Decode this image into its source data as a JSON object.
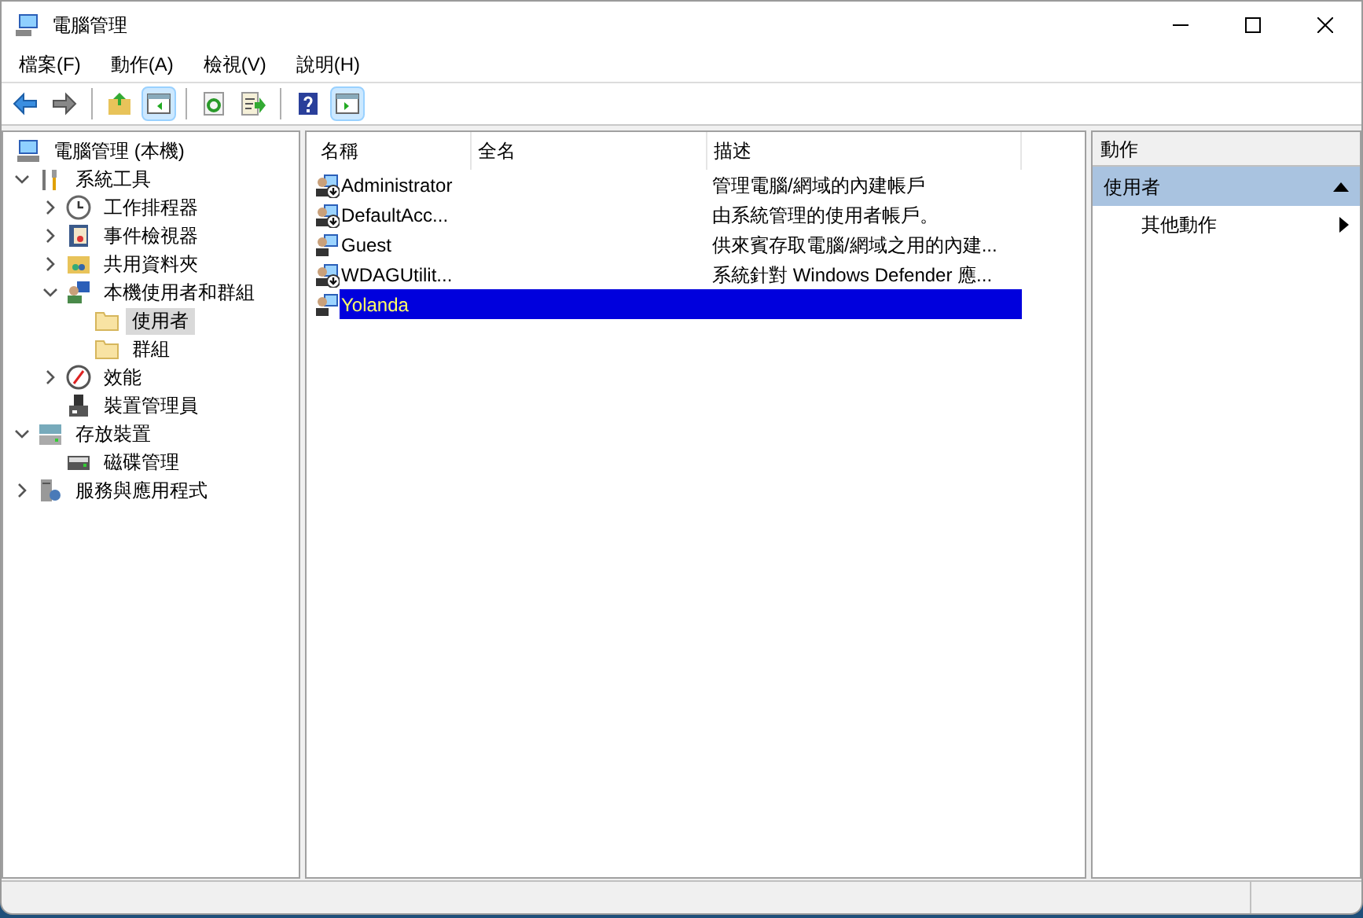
{
  "window": {
    "title": "電腦管理"
  },
  "menu": [
    "檔案(F)",
    "動作(A)",
    "檢視(V)",
    "說明(H)"
  ],
  "toolbar": [
    {
      "kind": "back",
      "pressed": false
    },
    {
      "kind": "forward",
      "pressed": false
    },
    {
      "kind": "separator"
    },
    {
      "kind": "up",
      "pressed": false
    },
    {
      "kind": "tree",
      "pressed": true
    },
    {
      "kind": "separator"
    },
    {
      "kind": "refresh",
      "pressed": false
    },
    {
      "kind": "export",
      "pressed": false
    },
    {
      "kind": "separator"
    },
    {
      "kind": "help",
      "pressed": false
    },
    {
      "kind": "actions",
      "pressed": true
    }
  ],
  "tree": [
    {
      "label": "電腦管理 (本機)",
      "kind": "computer",
      "selected": false,
      "children": [
        {
          "label": "系統工具",
          "kind": "tools",
          "expanded": true,
          "selected": false,
          "children": [
            {
              "label": "工作排程器",
              "kind": "clock",
              "expanded": false,
              "selected": false
            },
            {
              "label": "事件檢視器",
              "kind": "event",
              "expanded": false,
              "selected": false
            },
            {
              "label": "共用資料夾",
              "kind": "share",
              "expanded": false,
              "selected": false
            },
            {
              "label": "本機使用者和群組",
              "kind": "users",
              "expanded": true,
              "selected": false,
              "children": [
                {
                  "label": "使用者",
                  "kind": "folder",
                  "selected": true
                },
                {
                  "label": "群組",
                  "kind": "folder",
                  "selected": false
                }
              ]
            },
            {
              "label": "效能",
              "kind": "perf",
              "expanded": false,
              "selected": false
            },
            {
              "label": "裝置管理員",
              "kind": "device",
              "selected": false
            }
          ]
        },
        {
          "label": "存放裝置",
          "kind": "storage",
          "expanded": true,
          "selected": false,
          "children": [
            {
              "label": "磁碟管理",
              "kind": "disk",
              "selected": false
            }
          ]
        },
        {
          "label": "服務與應用程式",
          "kind": "services",
          "expanded": false,
          "selected": false
        }
      ]
    }
  ],
  "table": {
    "columns": [
      "名稱",
      "全名",
      "描述"
    ],
    "rows": [
      {
        "name": "Administrator",
        "description": "管理電腦/網域的內建帳戶",
        "disabled": true,
        "selected": false
      },
      {
        "name": "DefaultAcc...",
        "description": "由系統管理的使用者帳戶。",
        "disabled": true,
        "selected": false
      },
      {
        "name": "Guest",
        "description": "供來賓存取電腦/網域之用的內建...",
        "disabled": false,
        "selected": false
      },
      {
        "name": "WDAGUtilit...",
        "description": "系統針對 Windows Defender 應...",
        "disabled": true,
        "selected": false
      },
      {
        "name": "Yolanda",
        "description": "",
        "disabled": false,
        "selected": true
      }
    ]
  },
  "actions": {
    "title": "動作",
    "sections": [
      {
        "title": "使用者",
        "expanded": true,
        "items": [
          {
            "label": "其他動作",
            "submenu": true
          }
        ]
      }
    ]
  }
}
